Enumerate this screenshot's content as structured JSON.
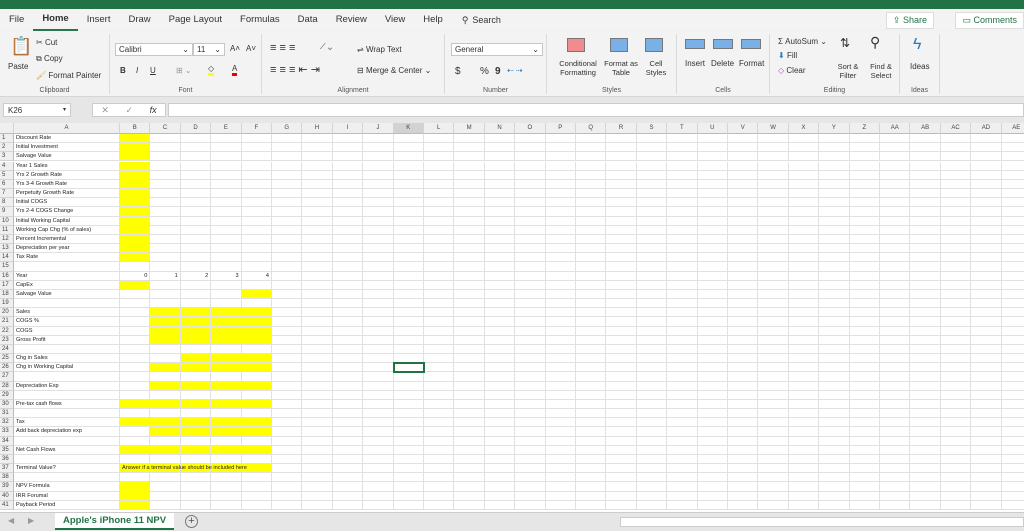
{
  "menu": {
    "tabs": [
      "File",
      "Home",
      "Insert",
      "Draw",
      "Page Layout",
      "Formulas",
      "Data",
      "Review",
      "View",
      "Help"
    ],
    "active": "Home",
    "search": "Search",
    "share": "Share",
    "comments": "Comments"
  },
  "ribbon": {
    "clipboard": {
      "paste": "Paste",
      "cut": "Cut",
      "copy": "Copy",
      "format_painter": "Format Painter",
      "label": "Clipboard"
    },
    "font": {
      "name": "Calibri",
      "size": "11",
      "bold": "B",
      "italic": "I",
      "underline": "U",
      "label": "Font"
    },
    "alignment": {
      "wrap": "Wrap Text",
      "merge": "Merge & Center",
      "label": "Alignment"
    },
    "number": {
      "format": "General",
      "currency": "$",
      "percent": "%",
      "comma": "9",
      "label": "Number"
    },
    "styles": {
      "conditional": "Conditional Formatting",
      "table": "Format as Table",
      "cell": "Cell Styles",
      "label": "Styles"
    },
    "cells": {
      "insert": "Insert",
      "delete": "Delete",
      "format": "Format",
      "label": "Cells"
    },
    "editing": {
      "autosum": "AutoSum",
      "fill": "Fill",
      "clear": "Clear",
      "sort": "Sort & Filter",
      "find": "Find & Select",
      "label": "Editing"
    },
    "ideas": {
      "button": "Ideas",
      "label": "Ideas"
    }
  },
  "formula_bar": {
    "name_box": "K26",
    "fx": "fx",
    "value": ""
  },
  "columns": [
    "A",
    "B",
    "C",
    "D",
    "E",
    "F",
    "G",
    "H",
    "I",
    "J",
    "K",
    "L",
    "M",
    "N",
    "O",
    "P",
    "Q",
    "R",
    "S",
    "T",
    "U",
    "V",
    "W",
    "X",
    "Y",
    "Z",
    "AA",
    "AB",
    "AC",
    "AD",
    "AE"
  ],
  "selected_cell": "K26",
  "highlight_color": "#ffff00",
  "rows": [
    {
      "A": "Discount Rate",
      "y": [
        "B"
      ]
    },
    {
      "A": "Initial Investment",
      "y": [
        "B"
      ]
    },
    {
      "A": "Salvage Value",
      "y": [
        "B"
      ]
    },
    {
      "A": "Year 1 Sales",
      "y": [
        "B"
      ]
    },
    {
      "A": "Yrs 2 Growth Rate",
      "y": [
        "B"
      ]
    },
    {
      "A": "Yrs 3-4 Growth Rate",
      "y": [
        "B"
      ]
    },
    {
      "A": "Perpetuity Growth Rate",
      "y": [
        "B"
      ]
    },
    {
      "A": "Initial COGS",
      "y": [
        "B"
      ]
    },
    {
      "A": "Yrs 2-4 COGS Change",
      "y": [
        "B"
      ]
    },
    {
      "A": "Initial Working Capital",
      "y": [
        "B"
      ]
    },
    {
      "A": "Working Cap Chg (% of sales)",
      "y": [
        "B"
      ]
    },
    {
      "A": "Percent Incremental",
      "y": [
        "B"
      ]
    },
    {
      "A": "Depreciation per year",
      "y": [
        "B"
      ]
    },
    {
      "A": "Tax Rate",
      "y": [
        "B"
      ]
    },
    {
      "A": "",
      "y": []
    },
    {
      "A": "Year",
      "B": "0",
      "C": "1",
      "D": "2",
      "E": "3",
      "F": "4",
      "y": []
    },
    {
      "A": "CapEx",
      "y": [
        "B"
      ]
    },
    {
      "A": "Salvage Value",
      "y": [
        "F"
      ]
    },
    {
      "A": "",
      "y": []
    },
    {
      "A": "Sales",
      "y": [
        "C",
        "D",
        "E",
        "F"
      ]
    },
    {
      "A": "COGS %",
      "y": [
        "C",
        "D",
        "E",
        "F"
      ]
    },
    {
      "A": "COGS",
      "y": [
        "C",
        "D",
        "E",
        "F"
      ]
    },
    {
      "A": "Gross Profit",
      "y": [
        "C",
        "D",
        "E",
        "F"
      ]
    },
    {
      "A": "",
      "y": []
    },
    {
      "A": "Chg in Sales",
      "y": [
        "D",
        "E",
        "F"
      ]
    },
    {
      "A": "Chg in Working Capital",
      "y": [
        "C",
        "D",
        "E",
        "F"
      ]
    },
    {
      "A": "",
      "y": []
    },
    {
      "A": "Depreciation Exp",
      "y": [
        "C",
        "D",
        "E",
        "F"
      ]
    },
    {
      "A": "",
      "y": []
    },
    {
      "A": "Pre-tax cash flows",
      "y": [
        "B",
        "C",
        "D",
        "E",
        "F"
      ]
    },
    {
      "A": "",
      "y": []
    },
    {
      "A": "Tax",
      "y": [
        "B",
        "C",
        "D",
        "E",
        "F"
      ]
    },
    {
      "A": "Add back depreciation exp",
      "y": [
        "C",
        "D",
        "E",
        "F"
      ]
    },
    {
      "A": "",
      "y": []
    },
    {
      "A": "Net Cash Flows",
      "y": [
        "B",
        "C",
        "D",
        "E",
        "F"
      ]
    },
    {
      "A": "",
      "y": []
    },
    {
      "A": "Terminal Value?",
      "B": "Answer if a terminal value should be included here",
      "y": [
        "B",
        "C",
        "D",
        "E",
        "F"
      ]
    },
    {
      "A": "",
      "y": []
    },
    {
      "A": "NPV Formula",
      "y": [
        "B"
      ]
    },
    {
      "A": "IRR Forumal",
      "y": [
        "B"
      ]
    },
    {
      "A": "Payback Period",
      "y": [
        "B"
      ]
    }
  ],
  "sheet_tabs": {
    "active": "Apple's iPhone 11 NPV",
    "add": "+"
  }
}
